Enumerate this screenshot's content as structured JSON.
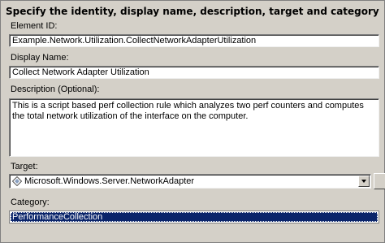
{
  "heading": "Specify the identity, display name, description, target and category",
  "element_id": {
    "label": "Element ID:",
    "value": "Example.Network.Utilization.CollectNetworkAdapterUtilization"
  },
  "display_name": {
    "label": "Display Name:",
    "value": "Collect Network Adapter Utilization"
  },
  "description": {
    "label": "Description (Optional):",
    "value": "This is a script based perf collection rule which analyzes two perf counters and computes the total network utilization of the interface on the computer."
  },
  "target": {
    "label": "Target:",
    "value": "Microsoft.Windows.Server.NetworkAdapter",
    "icon": "class-diamond-icon"
  },
  "category": {
    "label": "Category:",
    "selected": "PerformanceCollection"
  },
  "colors": {
    "background": "#d4d0c8",
    "selection": "#0a246a"
  }
}
